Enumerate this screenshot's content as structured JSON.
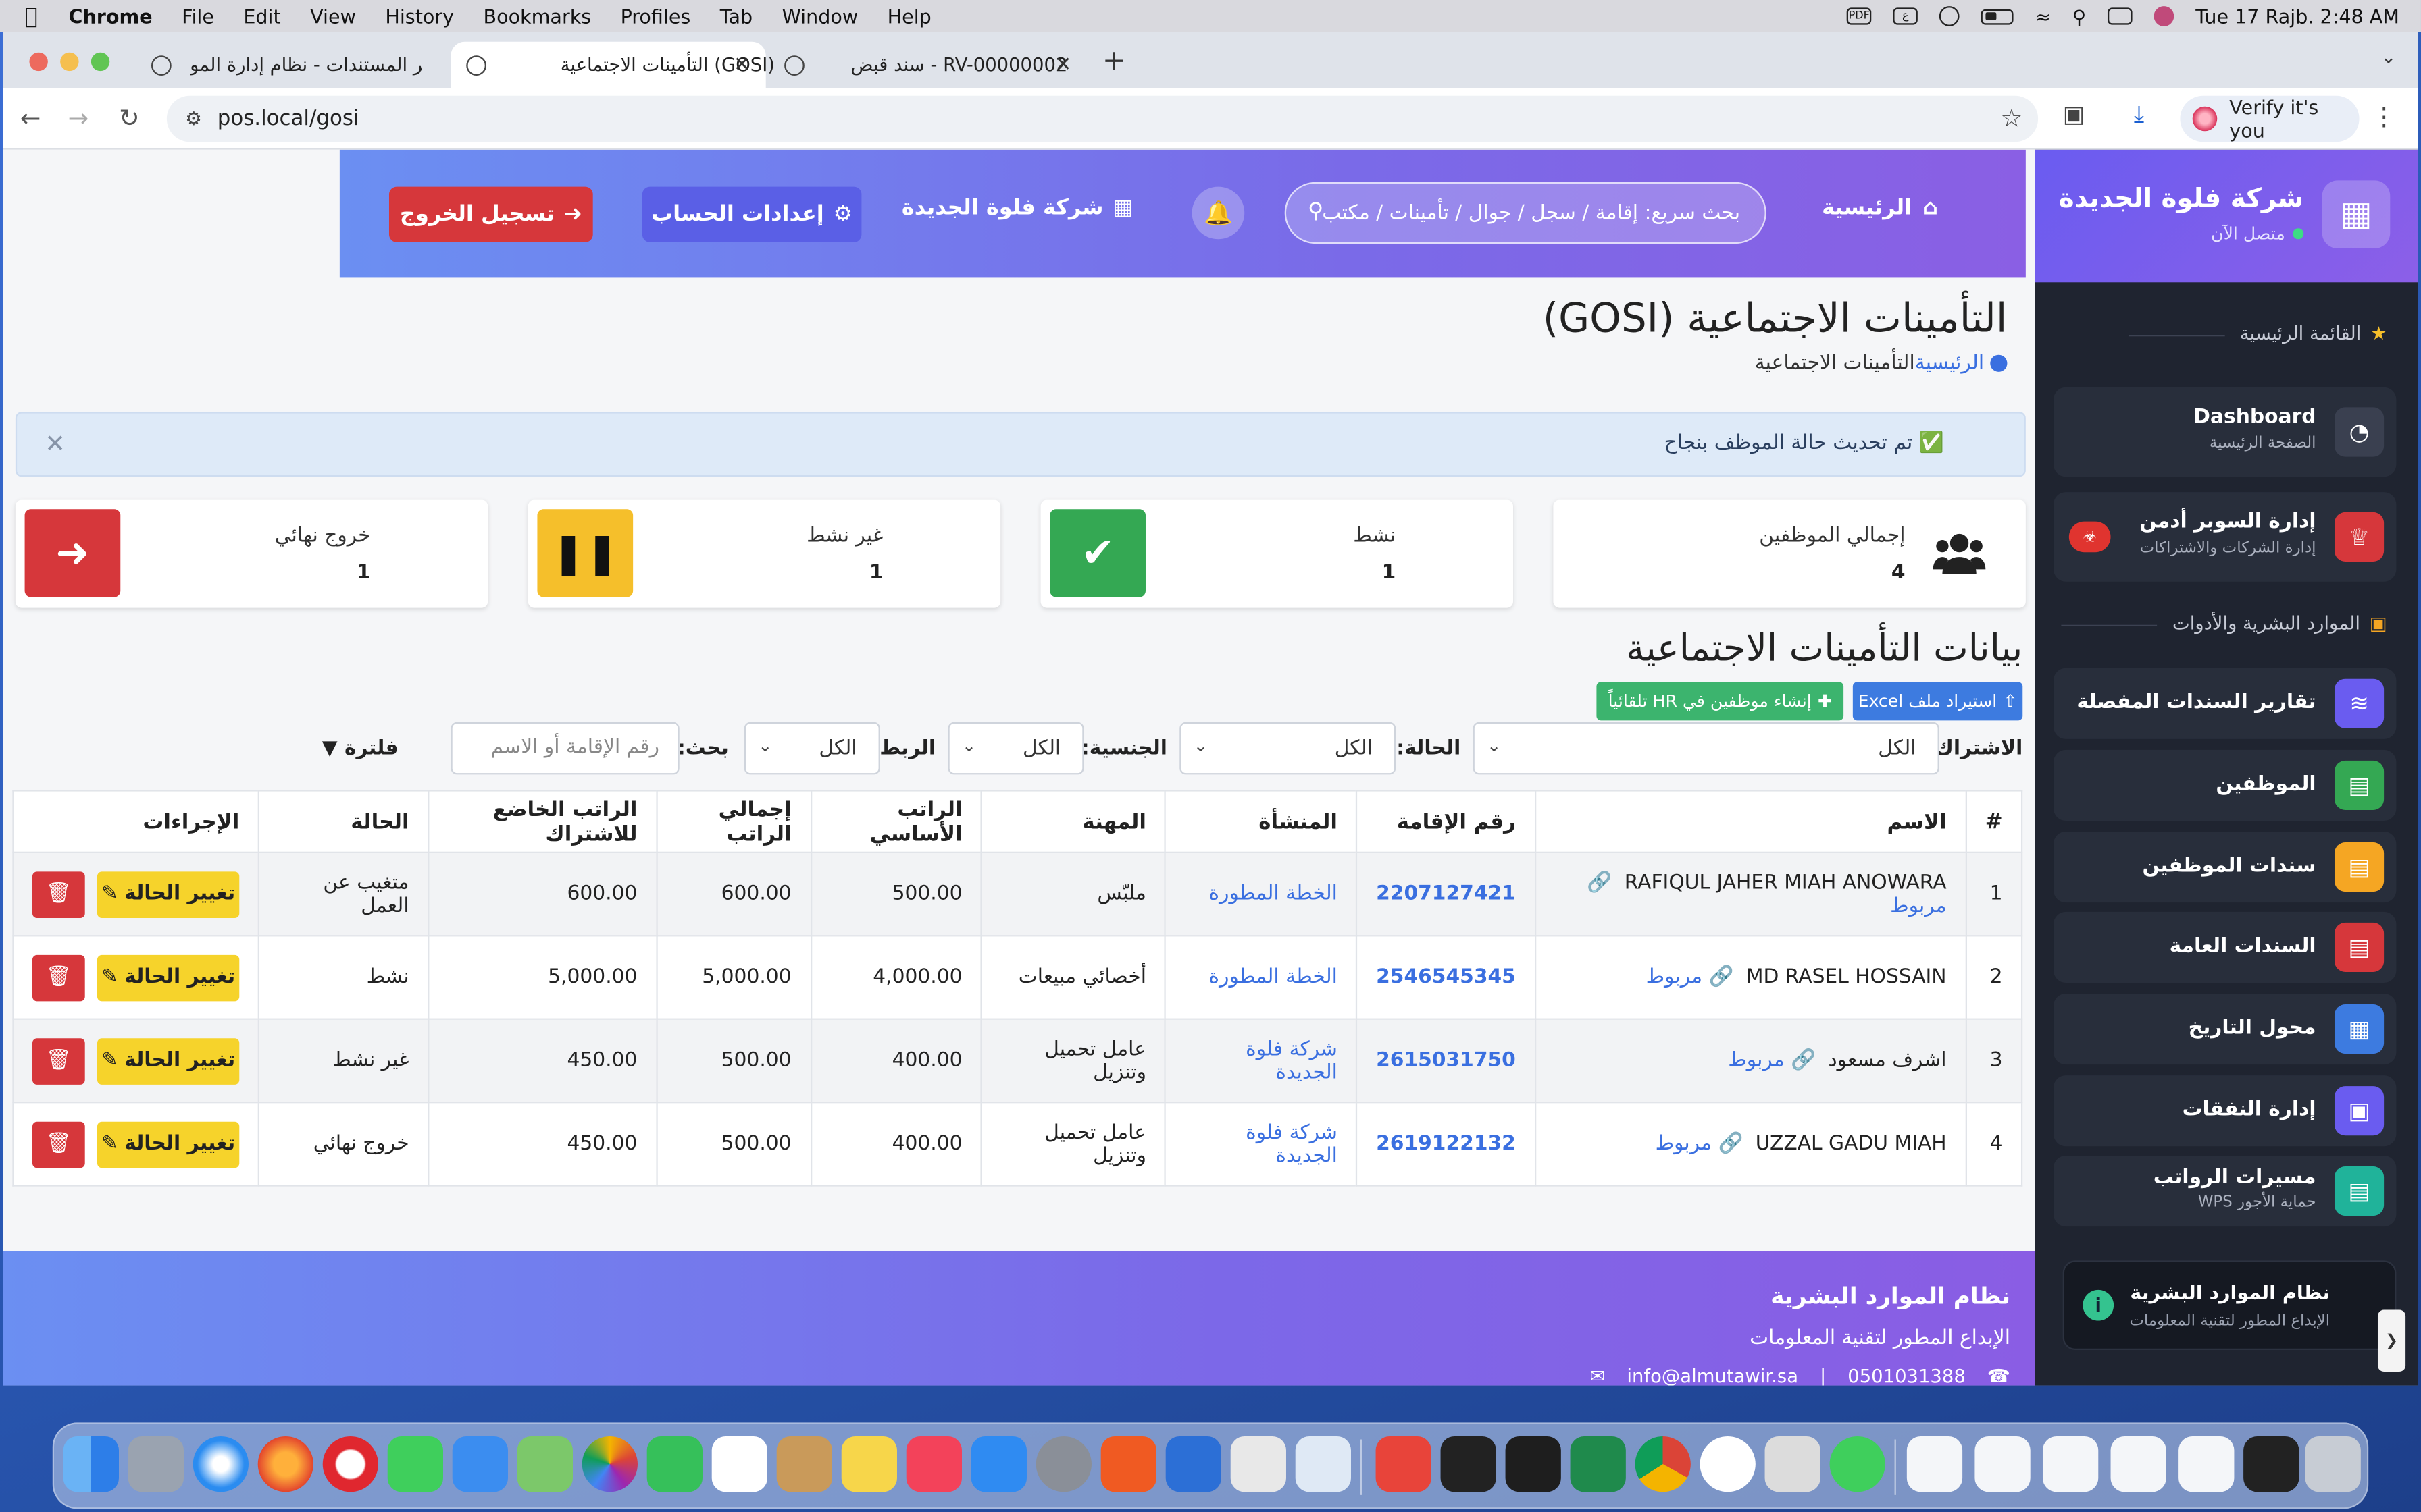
{
  "menubar": {
    "app": "Chrome",
    "items": [
      "File",
      "Edit",
      "View",
      "History",
      "Bookmarks",
      "Profiles",
      "Tab",
      "Window",
      "Help"
    ],
    "clock": "Tue 17 Rajb.  2:48 AM",
    "input_label": "ع",
    "pdf_label": "PDF"
  },
  "tabs": [
    {
      "title": "تقارير المستندات - نظام إدارة المو"
    },
    {
      "title": "التأمينات الاجتماعية (GOSI)"
    },
    {
      "title": "سند قبض - RV-00000002"
    }
  ],
  "toolbar": {
    "url": "pos.local/gosi",
    "verify": "Verify it's you"
  },
  "sidebar": {
    "company": "شركة فلوة الجديدة",
    "status": "متصل الآن",
    "section_main": "القائمة الرئيسية",
    "section_hr": "الموارد البشرية والأدوات",
    "items": [
      {
        "label": "Dashboard",
        "sub": "الصفحة الرئيسية"
      },
      {
        "label": "إدارة السوبر أدمن",
        "sub": "إدارة الشركات والاشتراكات"
      },
      {
        "label": "تقارير السندات المفصلة"
      },
      {
        "label": "الموظفين"
      },
      {
        "label": "سندات الموظفين"
      },
      {
        "label": "السندات العامة"
      },
      {
        "label": "محول التاريخ"
      },
      {
        "label": "إدارة النفقات"
      },
      {
        "label": "مسيرات الرواتب",
        "sub": "حماية الأجور WPS"
      }
    ],
    "footer_title": "نظام الموارد البشرية",
    "footer_sub": "الإبداع المطور لتقنية المعلومات"
  },
  "header": {
    "home": "الرئيسية",
    "search_placeholder": "بحث سريع: إقامة / سجل / جوال / تأمينات / مكتب",
    "company": "شركة فلوة الجديدة",
    "account": "إعدادات الحساب",
    "logout": "تسجيل الخروج"
  },
  "page": {
    "title": "التأمينات الاجتماعية (GOSI)",
    "breadcrumb_home": "الرئيسية",
    "breadcrumb_current": "التأمينات الاجتماعية",
    "alert": "✅ تم تحديث حالة الموظف بنجاح",
    "stats": [
      {
        "label": "إجمالي الموظفين",
        "value": "4"
      },
      {
        "label": "نشط",
        "value": "1"
      },
      {
        "label": "غير نشط",
        "value": "1"
      },
      {
        "label": "خروج نهائي",
        "value": "1"
      }
    ],
    "section_title": "بيانات التأمينات الاجتماعية",
    "import_btn": "استيراد ملف Excel",
    "create_btn": "إنشاء موظفين في HR تلقائياً",
    "filters": {
      "subscription_label": "الاشتراك:",
      "subscription_value": "الكل",
      "status_label": "الحالة:",
      "status_value": "الكل",
      "nationality_label": "الجنسية:",
      "nationality_value": "الكل",
      "link_label": "الربط:",
      "link_value": "الكل",
      "search_label": "بحث:",
      "search_placeholder": "رقم الإقامة أو الاسم",
      "filter_toggle": "فلترة"
    },
    "table": {
      "headers": [
        "#",
        "الاسم",
        "رقم الإقامة",
        "المنشأة",
        "المهنة",
        "الراتب الأساسي",
        "إجمالي الراتب",
        "الراتب الخاضع للاشتراك",
        "الحالة",
        "الإجراءات"
      ],
      "linked_label": "مربوط",
      "change_status": "تغيير الحالة",
      "rows": [
        {
          "n": "1",
          "name": "RAFIQUL JAHER MIAH ANOWARA",
          "iqama": "2207127421",
          "establishment": "الخطة المطورة",
          "job": "ملبّس",
          "basic": "500.00",
          "total": "600.00",
          "subject": "600.00",
          "status": "متغيب عن العمل"
        },
        {
          "n": "2",
          "name": "MD RASEL HOSSAIN",
          "iqama": "2546545345",
          "establishment": "الخطة المطورة",
          "job": "أخصائي مبيعات",
          "basic": "4,000.00",
          "total": "5,000.00",
          "subject": "5,000.00",
          "status": "نشط"
        },
        {
          "n": "3",
          "name": "اشرف مسعود",
          "iqama": "2615031750",
          "establishment": "شركة فلوة الجديدة",
          "job": "عامل تحميل وتنزيل",
          "basic": "400.00",
          "total": "500.00",
          "subject": "450.00",
          "status": "غير نشط"
        },
        {
          "n": "4",
          "name": "UZZAL GADU MIAH",
          "iqama": "2619122132",
          "establishment": "شركة فلوة الجديدة",
          "job": "عامل تحميل وتنزيل",
          "basic": "400.00",
          "total": "500.00",
          "subject": "450.00",
          "status": "خروج نهائي"
        }
      ]
    }
  },
  "footer": {
    "title": "نظام الموارد البشرية",
    "subtitle": "الإبداع المطور لتقنية المعلومات",
    "phone": "0501031388",
    "separator": "|",
    "email": "info@almutawir.sa"
  },
  "colors": {
    "accent": "#6b5cf0",
    "danger": "#d6373b",
    "warning": "#f6d32b",
    "success": "#3cb46e",
    "link": "#3a6fe0",
    "sidebar_bg": "#1f2430"
  }
}
